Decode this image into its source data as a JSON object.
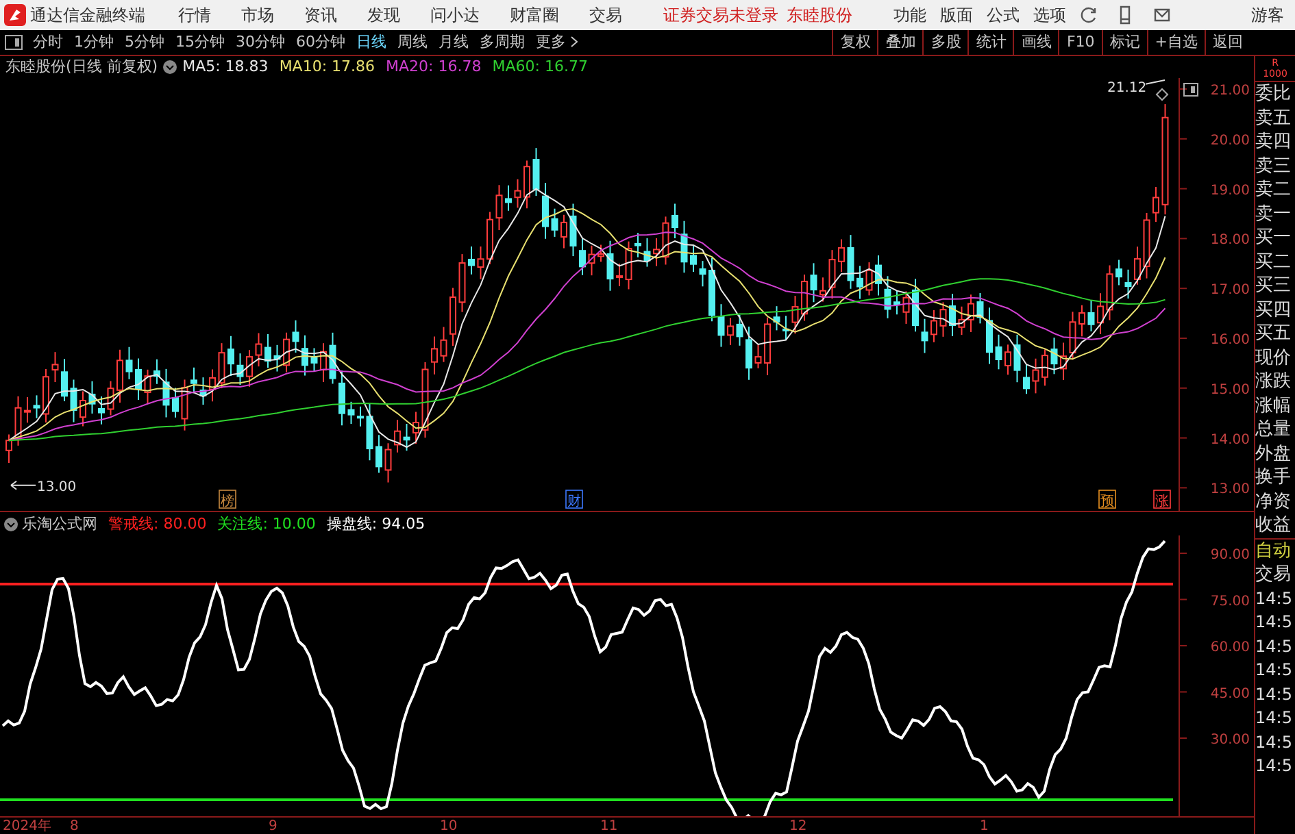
{
  "title_bar": {
    "app_name": "通达信金融终端",
    "menu": [
      "行情",
      "市场",
      "资讯",
      "发现",
      "问小达",
      "财富圈",
      "交易"
    ],
    "notice": "证券交易未登录",
    "stock_link": "东睦股份",
    "right_menu": [
      "功能",
      "版面",
      "公式",
      "选项"
    ],
    "user": "游客"
  },
  "period_tabs": [
    {
      "label": "分时",
      "selected": false
    },
    {
      "label": "1分钟",
      "selected": false
    },
    {
      "label": "5分钟",
      "selected": false
    },
    {
      "label": "15分钟",
      "selected": false
    },
    {
      "label": "30分钟",
      "selected": false
    },
    {
      "label": "60分钟",
      "selected": false
    },
    {
      "label": "日线",
      "selected": true
    },
    {
      "label": "周线",
      "selected": false
    },
    {
      "label": "月线",
      "selected": false
    },
    {
      "label": "多周期",
      "selected": false
    },
    {
      "label": "更多",
      "selected": false
    }
  ],
  "tools": [
    "复权",
    "叠加",
    "多股",
    "统计",
    "画线",
    "F10",
    "标记",
    "+自选",
    "返回"
  ],
  "main_chart": {
    "title": "东睦股份(日线 前复权)",
    "ma": [
      {
        "label": "MA5: 18.83",
        "color": "#e8e8e8"
      },
      {
        "label": "MA10: 17.86",
        "color": "#e8e070"
      },
      {
        "label": "MA20: 16.78",
        "color": "#d040d0"
      },
      {
        "label": "MA60: 16.77",
        "color": "#30d030"
      }
    ],
    "high_label": "21.12",
    "low_label": "13.00",
    "y_ticks": [
      "21.00",
      "20.00",
      "19.00",
      "18.00",
      "17.00",
      "16.00",
      "15.00",
      "14.00",
      "13.00"
    ],
    "events": [
      {
        "label": "榜",
        "color": "#c88a40"
      },
      {
        "label": "财",
        "color": "#3c78ff"
      },
      {
        "label": "预",
        "color": "#e89020"
      },
      {
        "label": "涨",
        "color": "#ff3c3c"
      }
    ]
  },
  "indicator": {
    "name": "乐淘公式网",
    "lines": [
      {
        "label": "警戒线: 80.00",
        "color": "#ff2020"
      },
      {
        "label": "关注线: 10.00",
        "color": "#20e020"
      },
      {
        "label": "操盘线: 94.05",
        "color": "#ffffff"
      }
    ],
    "y_ticks": [
      "90.00",
      "75.00",
      "60.00",
      "45.00",
      "30.00"
    ]
  },
  "time_axis": [
    "2024年",
    "8",
    "9",
    "10",
    "11",
    "12",
    "1"
  ],
  "side_panel": {
    "header": [
      "R",
      "1000"
    ],
    "quote_labels": [
      "委比",
      "卖五",
      "卖四",
      "卖三",
      "卖二",
      "卖一",
      "买一",
      "买二",
      "买三",
      "买四",
      "买五",
      "现价",
      "涨跌",
      "涨幅",
      "总量",
      "外盘",
      "换手",
      "净资",
      "收益"
    ],
    "mode_tab": "自动",
    "trade_label": "交易",
    "times": [
      "14:5",
      "14:5",
      "14:5",
      "14:5",
      "14:5",
      "14:5",
      "14:5",
      "14:5"
    ]
  }
}
